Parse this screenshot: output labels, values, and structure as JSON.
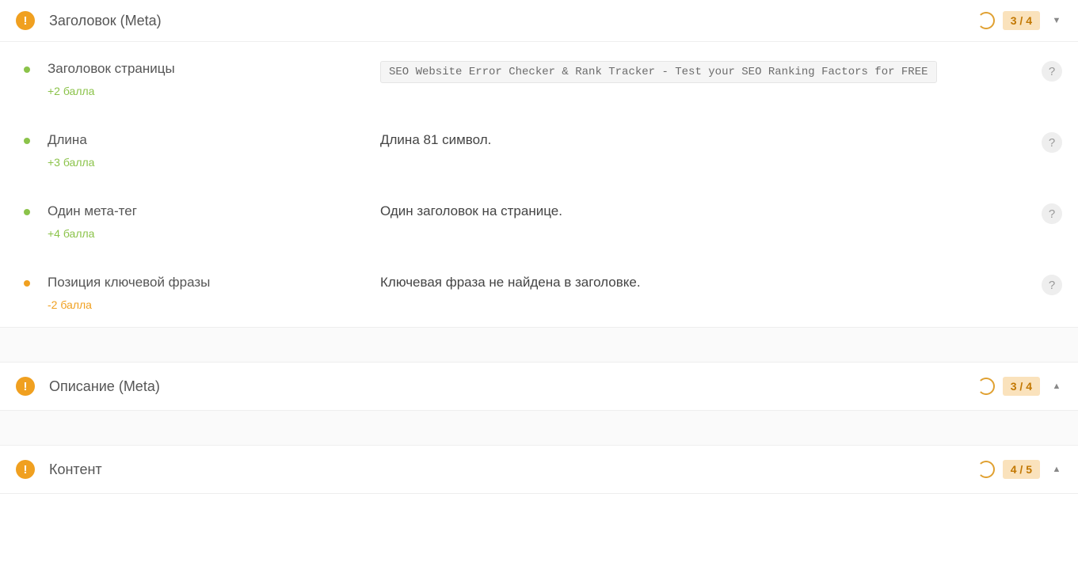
{
  "sections": [
    {
      "id": "meta-title",
      "title": "Заголовок (Meta)",
      "score": "3 / 4",
      "expanded": true,
      "rows": [
        {
          "id": "page-title",
          "dot": "green",
          "title": "Заголовок страницы",
          "points": "+2 балла",
          "points_sign": "positive",
          "value_type": "code",
          "value": "SEO Website Error Checker & Rank Tracker - Test your SEO Ranking Factors for FREE"
        },
        {
          "id": "length",
          "dot": "green",
          "title": "Длина",
          "points": "+3 балла",
          "points_sign": "positive",
          "value_type": "text",
          "value": "Длина 81 символ."
        },
        {
          "id": "one-meta",
          "dot": "green",
          "title": "Один мета-тег",
          "points": "+4 балла",
          "points_sign": "positive",
          "value_type": "text",
          "value": "Один заголовок на странице."
        },
        {
          "id": "keyword-position",
          "dot": "orange",
          "title": "Позиция ключевой фразы",
          "points": "-2 балла",
          "points_sign": "negative",
          "value_type": "text",
          "value": "Ключевая фраза не найдена в заголовке."
        }
      ]
    },
    {
      "id": "meta-description",
      "title": "Описание (Meta)",
      "score": "3 / 4",
      "expanded": false
    },
    {
      "id": "content",
      "title": "Контент",
      "score": "4 / 5",
      "expanded": false
    }
  ]
}
